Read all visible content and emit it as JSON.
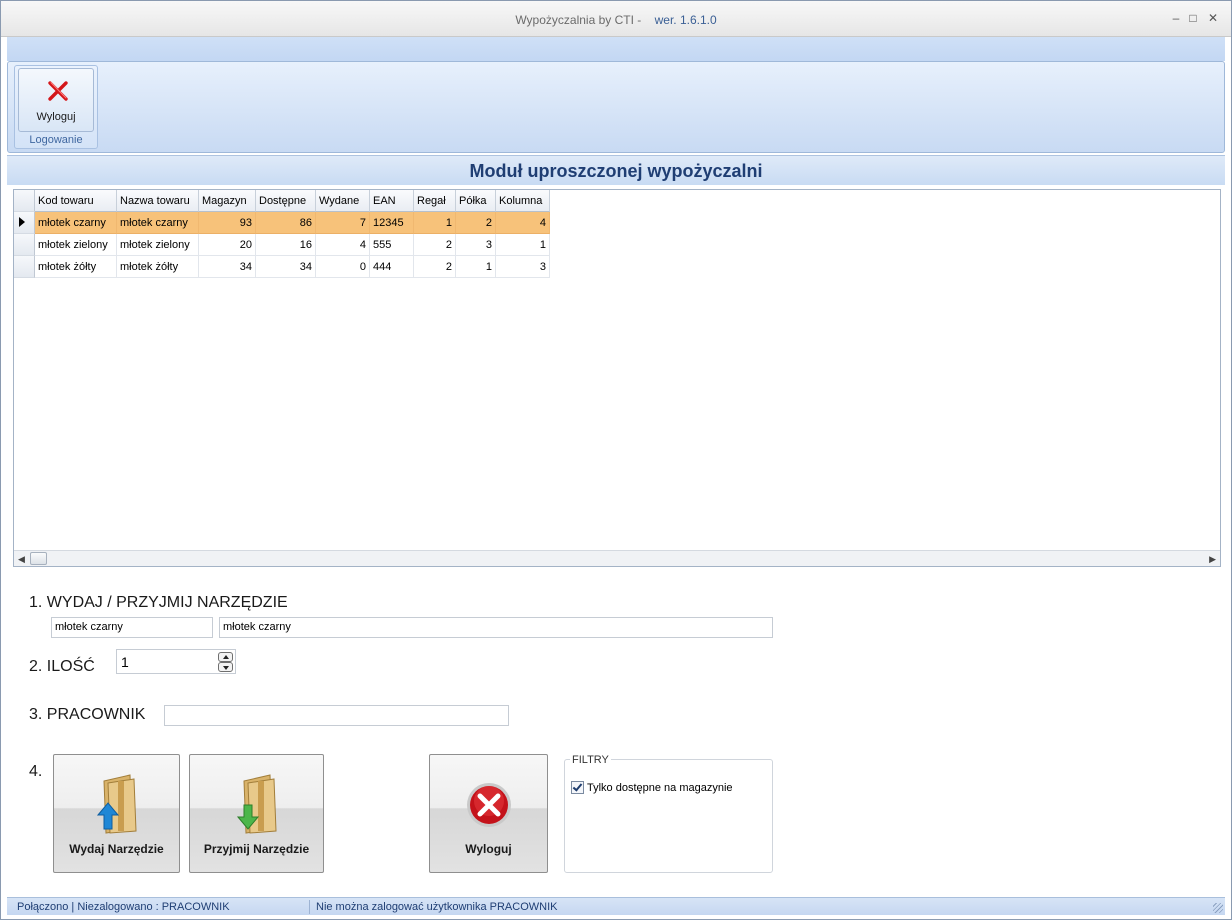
{
  "window": {
    "title": "Wypożyczalnia by CTI -",
    "version": "wer. 1.6.1.0",
    "minimize_glyph": "–",
    "maximize_glyph": "□",
    "close_glyph": "✕"
  },
  "ribbon": {
    "logout_button_label": "Wyloguj",
    "group_label": "Logowanie",
    "icons": {
      "logout": "red-x-icon"
    }
  },
  "module_title": "Moduł uproszczonej wypożyczalni",
  "grid": {
    "columns": [
      "Kod towaru",
      "Nazwa towaru",
      "Magazyn",
      "Dostępne",
      "Wydane",
      "EAN",
      "Regał",
      "Półka",
      "Kolumna"
    ],
    "rows": [
      [
        "młotek czarny",
        "młotek czarny",
        "93",
        "86",
        "7",
        "12345",
        "1",
        "2",
        "4"
      ],
      [
        "młotek zielony",
        "młotek zielony",
        "20",
        "16",
        "4",
        "555",
        "2",
        "3",
        "1"
      ],
      [
        "młotek żółty",
        "młotek żółty",
        "34",
        "34",
        "0",
        "444",
        "2",
        "1",
        "3"
      ]
    ],
    "selected_row": 0,
    "selection_color": "#f7c27a"
  },
  "form": {
    "step1_label": "1. WYDAJ / PRZYJMIJ NARZĘDZIE",
    "item_code_value": "młotek czarny",
    "item_name_value": "młotek czarny",
    "step2_label": "2. ILOŚĆ",
    "quantity_value": "1",
    "step3_label": "3. PRACOWNIK",
    "employee_value": "",
    "step4_label": "4."
  },
  "buttons": {
    "issue_label": "Wydaj Narzędzie",
    "receive_label": "Przyjmij Narzędzie",
    "logout_label": "Wyloguj",
    "icons": {
      "issue": "folder-blue-arrow-icon",
      "receive": "folder-green-arrow-icon",
      "logout": "red-circle-x-icon"
    }
  },
  "filters": {
    "legend": "FILTRY",
    "only_available_label": "Tylko dostępne na magazynie",
    "only_available_checked": true
  },
  "statusbar": {
    "connection": "Połączono | Niezalogowano : PRACOWNIK",
    "message": "Nie można zalogować użytkownika PRACOWNIK"
  }
}
